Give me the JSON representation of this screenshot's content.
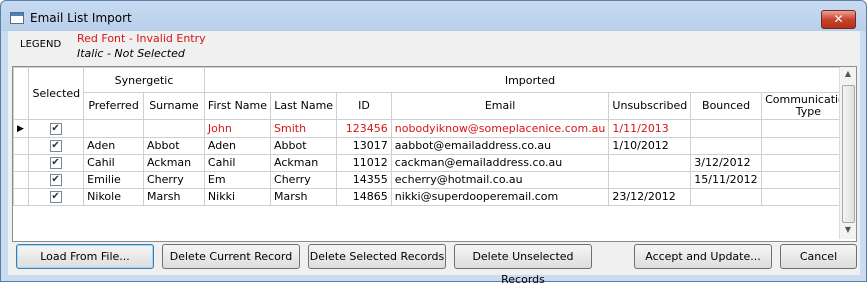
{
  "window": {
    "title": "Email List Import",
    "close_glyph": "✕"
  },
  "legend": {
    "label": "LEGEND",
    "red_text": "Red Font - Invalid Entry",
    "italic_text": "Italic - Not Selected",
    "red_color": "#d91515"
  },
  "grid": {
    "group_headers": {
      "selected": "Selected",
      "synergetic": "Synergetic",
      "imported": "Imported"
    },
    "columns": [
      "Preferred",
      "Surname",
      "First Name",
      "Last Name",
      "ID",
      "Email",
      "Unsubscribed",
      "Bounced",
      "Communication Type"
    ],
    "rows": [
      {
        "current": true,
        "selected": true,
        "invalid": true,
        "preferred": "",
        "surname": "",
        "first": "John",
        "last": "Smith",
        "id": "123456",
        "email": "nobodyiknow@someplacenice.com.au",
        "unsub": "1/11/2013",
        "bounced": "",
        "comm": ""
      },
      {
        "current": false,
        "selected": true,
        "invalid": false,
        "preferred": "Aden",
        "surname": "Abbot",
        "first": "Aden",
        "last": "Abbot",
        "id": "13017",
        "email": "aabbot@emailaddress.co.au",
        "unsub": "1/10/2012",
        "bounced": "",
        "comm": ""
      },
      {
        "current": false,
        "selected": true,
        "invalid": false,
        "preferred": "Cahil",
        "surname": "Ackman",
        "first": "Cahil",
        "last": "Ackman",
        "id": "11012",
        "email": "cackman@emailaddress.co.au",
        "unsub": "",
        "bounced": "3/12/2012",
        "comm": ""
      },
      {
        "current": false,
        "selected": true,
        "invalid": false,
        "preferred": "Emilie",
        "surname": "Cherry",
        "first": "Em",
        "last": "Cherry",
        "id": "14355",
        "email": "echerry@hotmail.co.au",
        "unsub": "",
        "bounced": "15/11/2012",
        "comm": ""
      },
      {
        "current": false,
        "selected": true,
        "invalid": false,
        "preferred": "Nikole",
        "surname": "Marsh",
        "first": "Nikki",
        "last": "Marsh",
        "id": "14865",
        "email": "nikki@superdooperemail.com",
        "unsub": "23/12/2012",
        "bounced": "",
        "comm": ""
      }
    ]
  },
  "buttons": {
    "load": "Load From File...",
    "delete_current": "Delete Current Record",
    "delete_selected": "Delete Selected Records",
    "delete_unselected": "Delete Unselected Records",
    "accept": "Accept and Update...",
    "cancel": "Cancel"
  }
}
